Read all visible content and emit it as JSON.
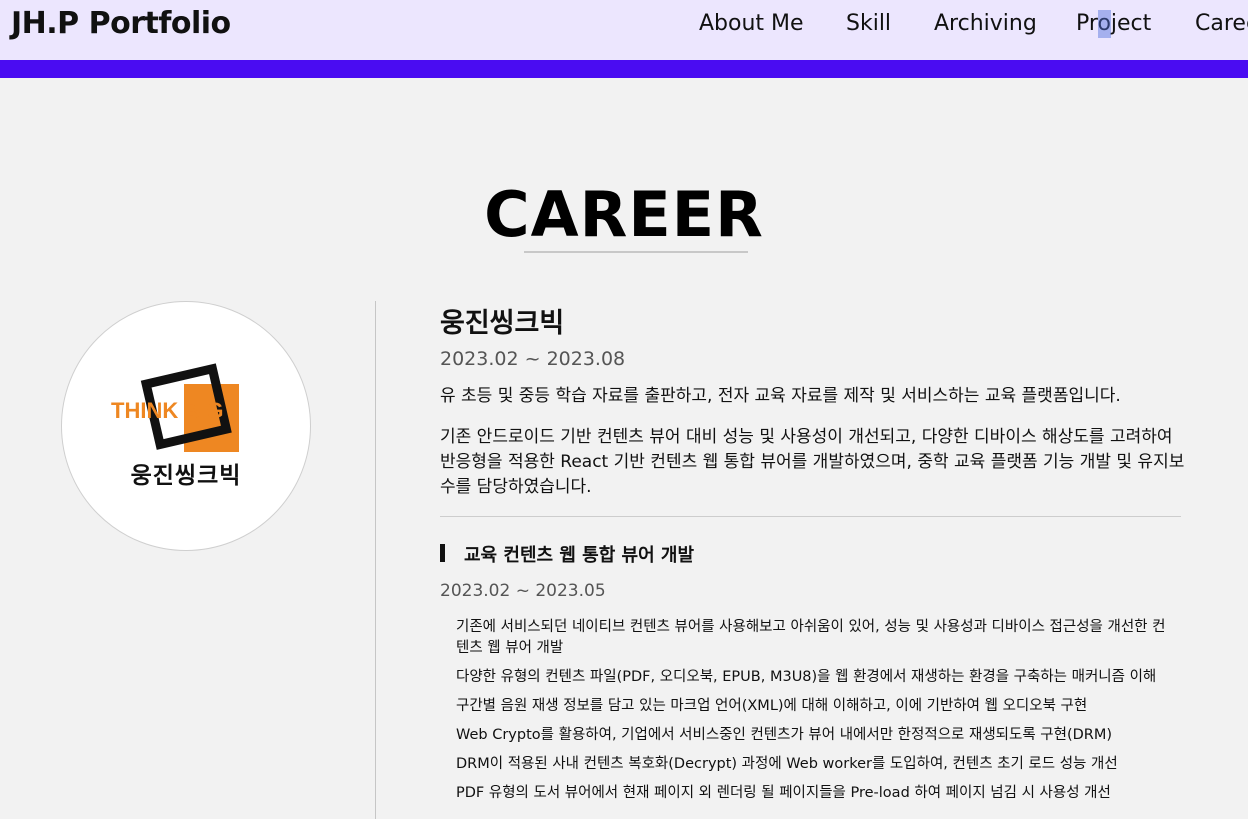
{
  "header": {
    "brand": "JH.P Portfolio",
    "nav": [
      "About Me",
      "Skill",
      "Archiving",
      "Project",
      "Caree"
    ]
  },
  "colors": {
    "header_bg": "#ece6fe",
    "accent": "#4a0cf2",
    "logo_orange": "#ee8722"
  },
  "section": {
    "title": "CAREER"
  },
  "career": {
    "logo": {
      "wordmark": "THINK BIG",
      "caption": "웅진씽크빅"
    },
    "company": "웅진씽크빅",
    "period": "2023.02 ~ 2023.08",
    "description1": "유 초등 및 중등 학습 자료를 출판하고, 전자 교육 자료를 제작 및 서비스하는 교육 플랫폼입니다.",
    "description2": "기존 안드로이드 기반 컨텐츠 뷰어 대비 성능 및 사용성이 개선되고, 다양한 디바이스 해상도를 고려하여 반응형을 적용한 React 기반 컨텐츠 웹 통합 뷰어를 개발하였으며, 중학 교육 플랫폼 기능 개발 및 유지보수를 담당하였습니다.",
    "project": {
      "title": "교육 컨텐츠 웹 통합 뷰어 개발",
      "period": "2023.02 ~ 2023.05",
      "items": [
        "기존에 서비스되던 네이티브 컨텐츠 뷰어를 사용해보고 아쉬움이 있어, 성능 및 사용성과 디바이스 접근성을 개선한 컨텐츠 웹 뷰어 개발",
        "다양한 유형의 컨텐츠 파일(PDF, 오디오북, EPUB, M3U8)을 웹 환경에서 재생하는 환경을 구축하는 매커니즘 이해",
        "구간별 음원 재생 정보를 담고 있는 마크업 언어(XML)에 대해 이해하고, 이에 기반하여 웹 오디오북 구현",
        "Web Crypto를 활용하여, 기업에서 서비스중인 컨텐츠가 뷰어 내에서만 한정적으로 재생되도록 구현(DRM)",
        "DRM이 적용된 사내 컨텐츠 복호화(Decrypt) 과정에 Web worker를 도입하여, 컨텐츠 초기 로드 성능 개선",
        "PDF 유형의 도서 뷰어에서 현재 페이지 외 렌더링 될 페이지들을 Pre-load 하여 페이지 넘김 시 사용성 개선"
      ]
    }
  }
}
